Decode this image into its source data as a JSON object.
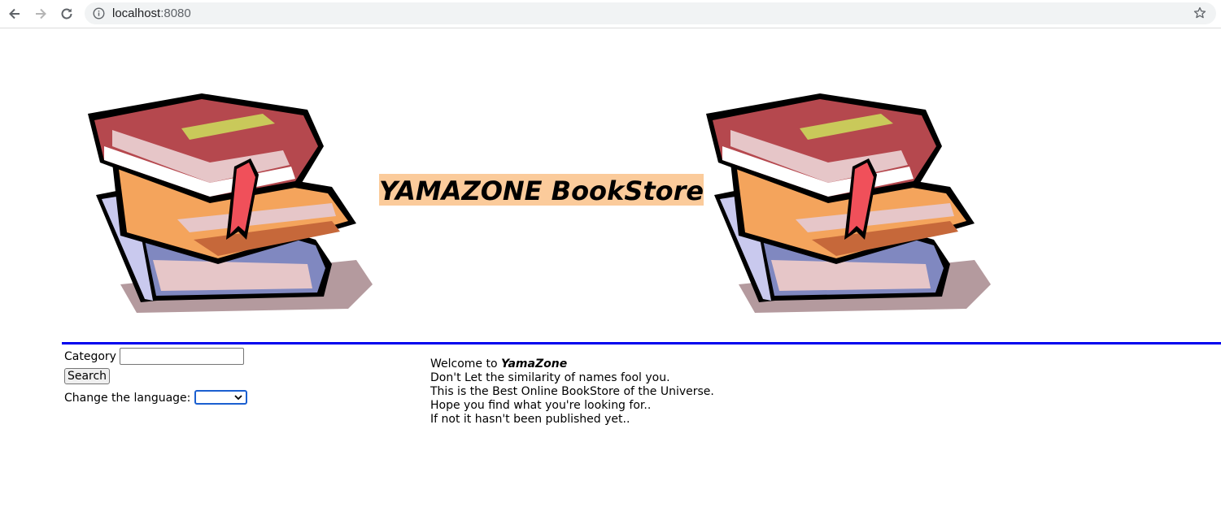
{
  "browser": {
    "url_host": "localhost",
    "url_port": ":8080"
  },
  "page": {
    "title": "YAMAZONE BookStore"
  },
  "search": {
    "category_label": "Category",
    "category_value": "",
    "search_button": "Search",
    "language_label": "Change the language:",
    "language_selected": ""
  },
  "welcome": {
    "prefix": "Welcome to ",
    "brand": "YamaZone",
    "lines": [
      "Don't Let the similarity of names fool you.",
      "This is the Best Online BookStore of the Universe.",
      "Hope you find what you're looking for..",
      "If not it hasn't been published yet.."
    ]
  },
  "colors": {
    "title_bg": "#fbcb9b",
    "rule": "#0000ee",
    "book_red": "#b5484e",
    "book_orange": "#f4a45c",
    "book_blue": "#8088c0"
  }
}
